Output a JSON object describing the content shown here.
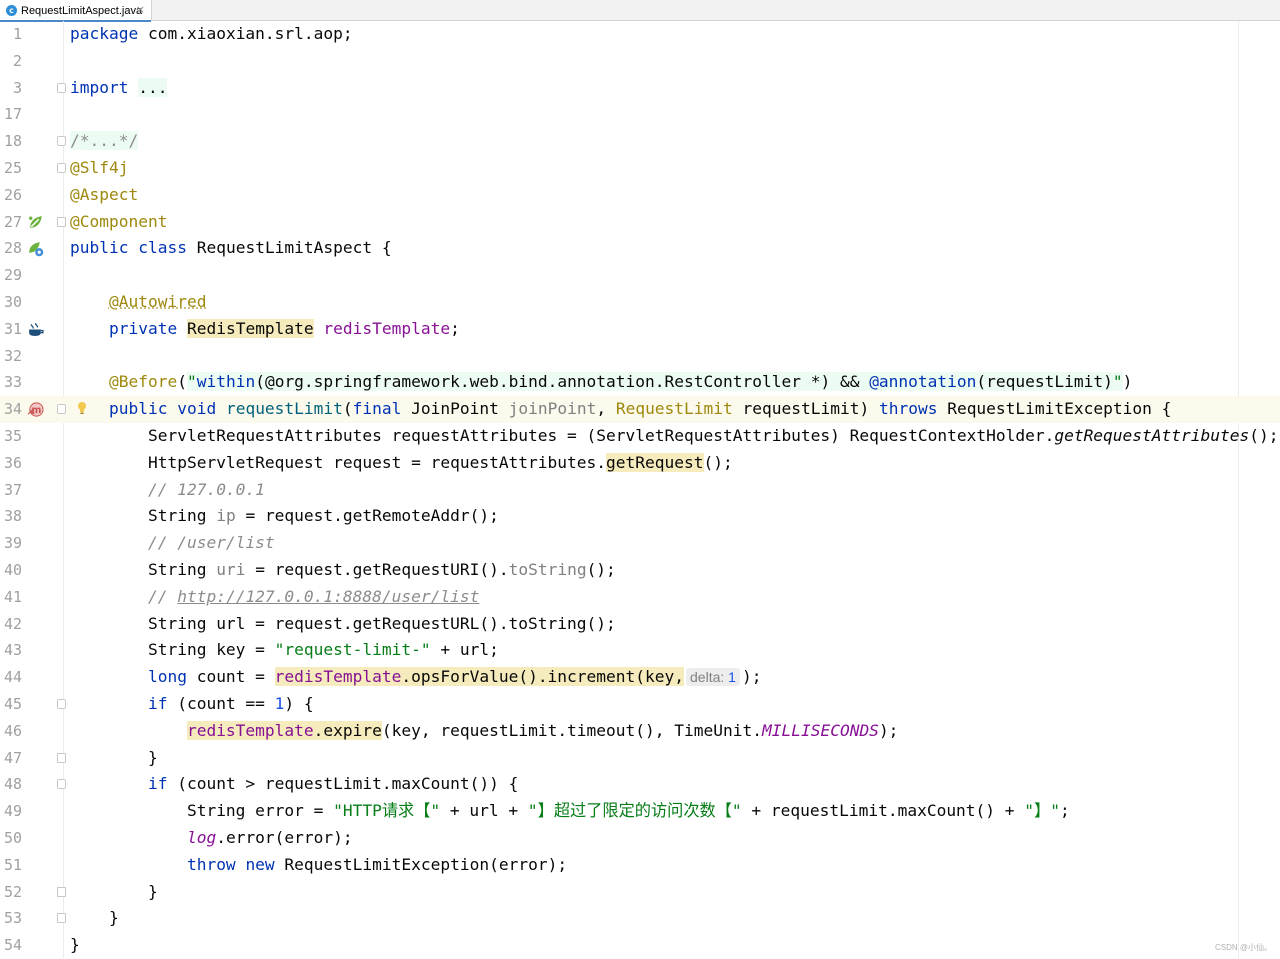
{
  "tab": {
    "label": "RequestLimitAspect.java",
    "icon": "java-class-icon",
    "close": "×",
    "file_badge": "c"
  },
  "watermark": "CSDN @小仙。",
  "code": {
    "line_numbers": [
      "1",
      "2",
      "3",
      "17",
      "18",
      "25",
      "26",
      "27",
      "28",
      "29",
      "30",
      "31",
      "32",
      "33",
      "34",
      "35",
      "36",
      "37",
      "38",
      "39",
      "40",
      "41",
      "42",
      "43",
      "44",
      "45",
      "46",
      "47",
      "48",
      "49",
      "50",
      "51",
      "52",
      "53",
      "54"
    ],
    "l1": {
      "kw": "package",
      "rest": " com.xiaoxian.srl.aop;"
    },
    "l3": {
      "kw": "import",
      "sp": " ",
      "fold": "..."
    },
    "l18": {
      "text": "/*...*/"
    },
    "l25": {
      "text": "@Slf4j"
    },
    "l26": {
      "text": "@Aspect"
    },
    "l27": {
      "text": "@Component"
    },
    "l28": {
      "kw1": "public",
      "kw2": "class",
      "rest": "RequestLimitAspect {"
    },
    "l30": {
      "ann": "@Autowired"
    },
    "l31": {
      "kw": "private",
      "type": "RedisTemplate",
      "field": "redisTemplate",
      "end": ";"
    },
    "l33": {
      "ann": "@Before",
      "open": "(",
      "q1": "\"",
      "within": "within",
      "mid": "(@org.springframework.web.bind.annotation.RestController *) && ",
      "annot": "@annotation",
      "arg": "(requestLimit)",
      "q2": "\"",
      "close": ")"
    },
    "l34": {
      "kw1": "public",
      "kw2": "void",
      "method": "requestLimit",
      "p1": "(",
      "final": "final",
      "jp_type": "JoinPoint",
      "jp_name": "joinPoint",
      "comma": ", ",
      "rl_type": "RequestLimit",
      "rl_name": " requestLimit) ",
      "throws": "throws",
      "exc": " RequestLimitException {"
    },
    "l35": {
      "a": "ServletRequestAttributes requestAttributes = (ServletRequestAttributes) RequestContextHolder.",
      "m": "getRequestAttributes",
      "b": "();"
    },
    "l36": {
      "a": "HttpServletRequest request = requestAttributes.",
      "m": "getRequest",
      "b": "();"
    },
    "l37": {
      "cmt": "// 127.0.0.1"
    },
    "l38": {
      "a": "String ",
      "var": "ip",
      "b": " = request.getRemoteAddr();"
    },
    "l39": {
      "cmt": "// /user/list"
    },
    "l40": {
      "a": "String ",
      "var": "uri",
      "b": " = request.getRequestURI().",
      "m": "toString",
      "c": "();"
    },
    "l41": {
      "cmt": "// ",
      "link": "http://127.0.0.1:8888/user/list"
    },
    "l42": {
      "a": "String url = request.getRequestURL().toString();"
    },
    "l43": {
      "a": "String key = ",
      "str": "\"request-limit-\"",
      "b": " + url;"
    },
    "l44": {
      "kw": "long",
      "a": " count = ",
      "field": "redisTemplate",
      "b": ".opsForValue().increment(key,",
      "hint_name": "delta:",
      "hint_val": "1",
      "c": ");"
    },
    "l45": {
      "kw": "if",
      "a": " (count == ",
      "num": "1",
      "b": ") {"
    },
    "l46": {
      "field": "redisTemplate",
      "m": ".expire",
      "a": "(key, requestLimit.timeout(), TimeUnit.",
      "sfld": "MILLISECONDS",
      "b": ");"
    },
    "l47": {
      "a": "}"
    },
    "l48": {
      "kw": "if",
      "a": " (count > requestLimit.maxCount()) {"
    },
    "l49": {
      "a": "String error = ",
      "s1": "\"HTTP请求【\"",
      "b": " + url + ",
      "s2": "\"】超过了限定的访问次数【\"",
      "c": " + requestLimit.maxCount() + ",
      "s3": "\"】\"",
      "d": ";"
    },
    "l50": {
      "sfld": "log",
      "a": ".error(error);"
    },
    "l51": {
      "kw1": "throw",
      "kw2": "new",
      "a": " RequestLimitException(error);"
    },
    "l52": {
      "a": "}"
    },
    "l53": {
      "a": "}"
    },
    "l54": {
      "a": "}"
    }
  },
  "colors": {
    "keyword": "#0033b3",
    "annotation": "#9e880d",
    "string": "#067d17",
    "number": "#1750eb",
    "comment": "#8c8c8c",
    "field": "#871094",
    "highlight": "#f6ebbc",
    "caret_line": "#fcfaed"
  },
  "gutter_icons": {
    "l27": "spring-bean-icon",
    "l28": "spring-aspect-icon",
    "l31": "autowired-bean-icon",
    "l34": "advice-method-icon",
    "l34_bulb": "intention-bulb-icon"
  }
}
